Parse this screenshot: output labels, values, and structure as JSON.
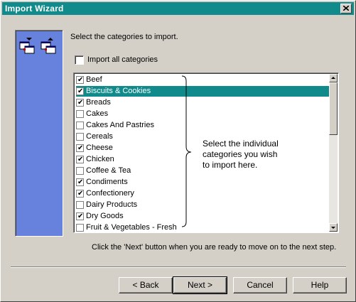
{
  "window": {
    "title": "Import Wizard"
  },
  "icons": {
    "close": "close-x-icon",
    "move_down": "move-down-icon",
    "move_up": "move-up-icon"
  },
  "instructions": "Select the categories to import.",
  "import_all": {
    "label": "Import all categories",
    "checked": false
  },
  "categories": [
    {
      "label": "Beef",
      "checked": true,
      "selected": false
    },
    {
      "label": "Biscuits & Cookies",
      "checked": true,
      "selected": true
    },
    {
      "label": "Breads",
      "checked": true,
      "selected": false
    },
    {
      "label": "Cakes",
      "checked": false,
      "selected": false
    },
    {
      "label": "Cakes And Pastries",
      "checked": false,
      "selected": false
    },
    {
      "label": "Cereals",
      "checked": false,
      "selected": false
    },
    {
      "label": "Cheese",
      "checked": true,
      "selected": false
    },
    {
      "label": "Chicken",
      "checked": true,
      "selected": false
    },
    {
      "label": "Coffee & Tea",
      "checked": false,
      "selected": false
    },
    {
      "label": "Condiments",
      "checked": true,
      "selected": false
    },
    {
      "label": "Confectionery",
      "checked": true,
      "selected": false
    },
    {
      "label": "Dairy Products",
      "checked": false,
      "selected": false
    },
    {
      "label": "Dry Goods",
      "checked": true,
      "selected": false
    },
    {
      "label": "Fruit & Vegetables - Fresh",
      "checked": false,
      "selected": false
    }
  ],
  "callout": [
    "Select the individual",
    "categories you wish",
    "to import here."
  ],
  "hint": "Click the 'Next' button when you are ready to move on to the next step.",
  "buttons": {
    "back": "< Back",
    "next": "Next >",
    "cancel": "Cancel",
    "help": "Help"
  },
  "colors": {
    "titlebar": "#108a8a",
    "selection": "#108a8a",
    "panel": "#6682dd",
    "dialog": "#d4d0c8"
  }
}
